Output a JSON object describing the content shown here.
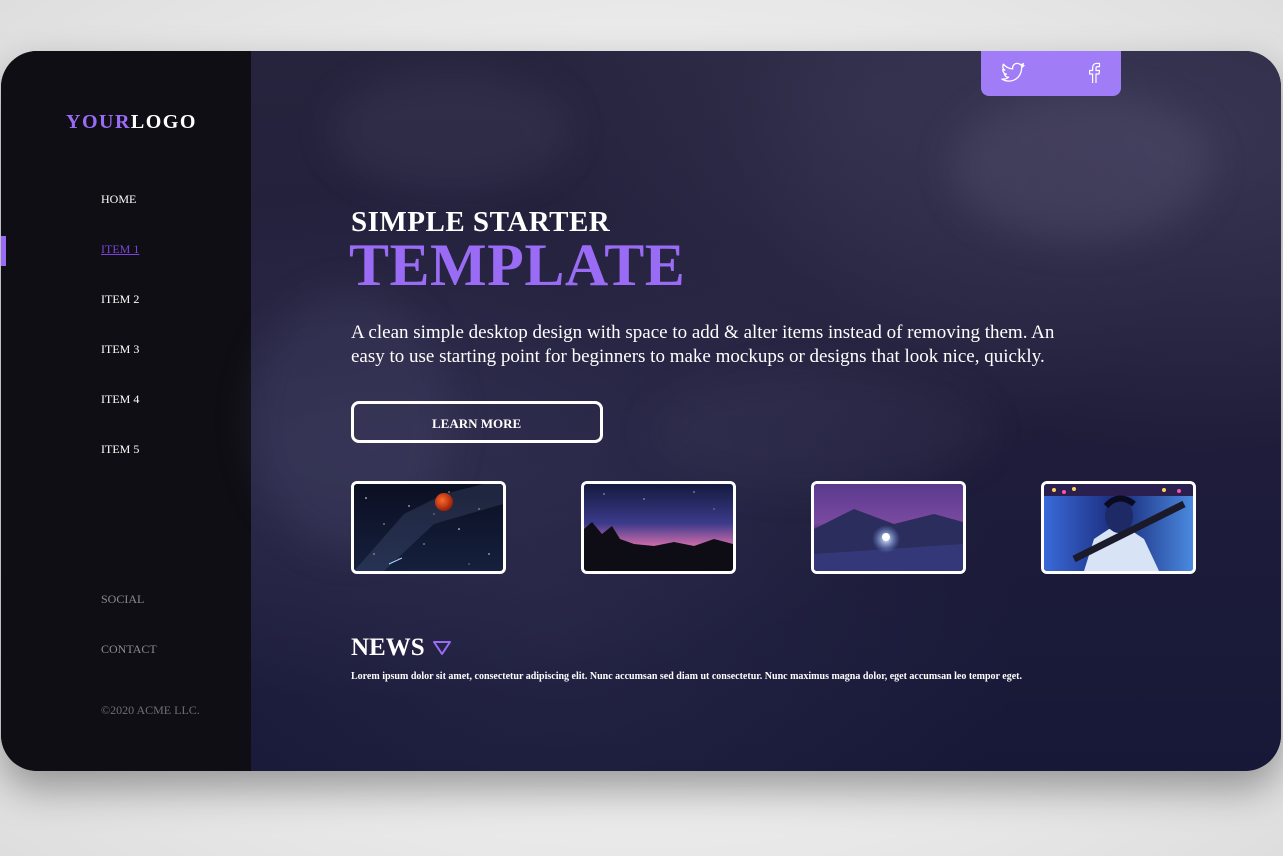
{
  "sidebar": {
    "logo": {
      "part1": "YOUR",
      "part2": "LOGO"
    },
    "nav": [
      "HOME",
      "ITEM 1",
      "ITEM 2",
      "ITEM 3",
      "ITEM 4",
      "ITEM 5"
    ],
    "active_item": "ITEM 1",
    "secondary": [
      "SOCIAL",
      "CONTACT"
    ],
    "copyright": "©2020 ACME LLC."
  },
  "social": {
    "icons": [
      "twitter-icon",
      "facebook-icon"
    ]
  },
  "hero": {
    "kicker": "SIMPLE STARTER",
    "title": "TEMPLATE",
    "description": "A clean simple desktop design with space to add & alter items instead of removing them. An easy to use starting point for beginners to make mockups or designs that look nice, quickly.",
    "button": "LEARN MORE"
  },
  "gallery": [
    "night-sky-blood-moon",
    "pink-sunset-rocks",
    "astronaut-light-painting",
    "neon-portrait"
  ],
  "news": {
    "title": "NEWS",
    "text": "Lorem ipsum dolor sit amet, consectetur adipiscing elit. Nunc accumsan sed diam ut consectetur. Nunc maximus magna dolor, eget accumsan leo tempor eget."
  },
  "colors": {
    "accent": "#9a6cf5",
    "sidebar": "#0f0e14",
    "background": "#1c1a33"
  }
}
